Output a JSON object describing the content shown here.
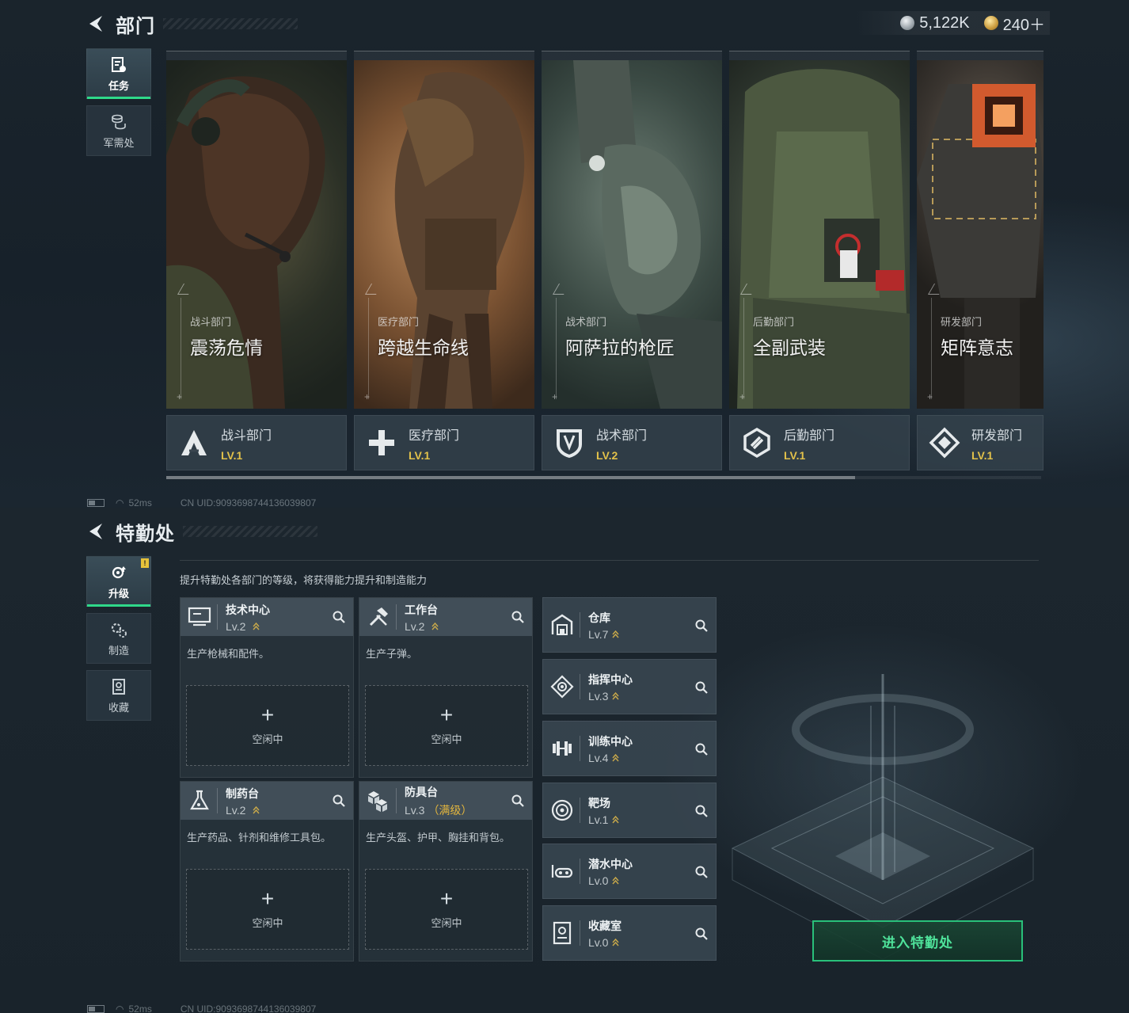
{
  "panel1": {
    "title": "部门",
    "currency": [
      {
        "icon": "silver-coin-icon",
        "value": "5,122K"
      },
      {
        "icon": "gold-coin-icon",
        "value": "240＋"
      }
    ],
    "tabs": [
      {
        "label": "任务",
        "icon": "task-icon",
        "active": true
      },
      {
        "label": "军需处",
        "icon": "supply-icon",
        "active": false
      }
    ],
    "cards": [
      {
        "category": "战斗部门",
        "name": "震荡危情",
        "dept": "战斗部门",
        "level": "LV.1",
        "icon": "combat-emblem-icon"
      },
      {
        "category": "医疗部门",
        "name": "跨越生命线",
        "dept": "医疗部门",
        "level": "LV.1",
        "icon": "medical-cross-icon"
      },
      {
        "category": "战术部门",
        "name": "阿萨拉的枪匠",
        "dept": "战术部门",
        "level": "LV.2",
        "icon": "tactical-shield-icon"
      },
      {
        "category": "后勤部门",
        "name": "全副武装",
        "dept": "后勤部门",
        "level": "LV.1",
        "icon": "logistics-hex-icon"
      },
      {
        "category": "研发部门",
        "name": "矩阵意志",
        "dept": "研发部门",
        "level": "LV.1",
        "icon": "research-diamond-icon"
      }
    ],
    "status": {
      "ping": "52ms",
      "uid": "CN UID:9093698744136039807"
    }
  },
  "panel2": {
    "title": "特勤处",
    "tabs": [
      {
        "label": "升级",
        "icon": "upgrade-gear-icon",
        "active": true,
        "badge": "!"
      },
      {
        "label": "制造",
        "icon": "craft-gears-icon",
        "active": false
      },
      {
        "label": "收藏",
        "icon": "collection-icon",
        "active": false
      }
    ],
    "description": "提升特勤处各部门的等级，将获得能力提升和制造能力",
    "stations": [
      {
        "name": "技术中心",
        "level": "Lv.2",
        "max": "",
        "desc": "生产枪械和配件。",
        "slot": "空闲中",
        "icon": "monitor-icon"
      },
      {
        "name": "工作台",
        "level": "Lv.2",
        "max": "",
        "desc": "生产子弹。",
        "slot": "空闲中",
        "icon": "hammer-icon"
      },
      {
        "name": "制药台",
        "level": "Lv.2",
        "max": "",
        "desc": "生产药品、针剂和维修工具包。",
        "slot": "空闲中",
        "icon": "flask-icon"
      },
      {
        "name": "防具台",
        "level": "Lv.3",
        "max": "（满级）",
        "desc": "生产头盔、护甲、胸挂和背包。",
        "slot": "空闲中",
        "icon": "armor-cubes-icon"
      }
    ],
    "facilities": [
      {
        "name": "仓库",
        "level": "Lv.7",
        "icon": "warehouse-icon"
      },
      {
        "name": "指挥中心",
        "level": "Lv.3",
        "icon": "command-center-icon"
      },
      {
        "name": "训练中心",
        "level": "Lv.4",
        "icon": "dumbbell-icon"
      },
      {
        "name": "靶场",
        "level": "Lv.1",
        "icon": "target-icon"
      },
      {
        "name": "潜水中心",
        "level": "Lv.0",
        "icon": "diving-mask-icon"
      },
      {
        "name": "收藏室",
        "level": "Lv.0",
        "icon": "collection-room-icon"
      }
    ],
    "enter_button": "进入特勤处",
    "status": {
      "ping": "52ms",
      "uid": "CN UID:9093698744136039807"
    }
  },
  "colors": {
    "accent_green": "#2fd98a",
    "level_gold": "#e2c14a"
  }
}
